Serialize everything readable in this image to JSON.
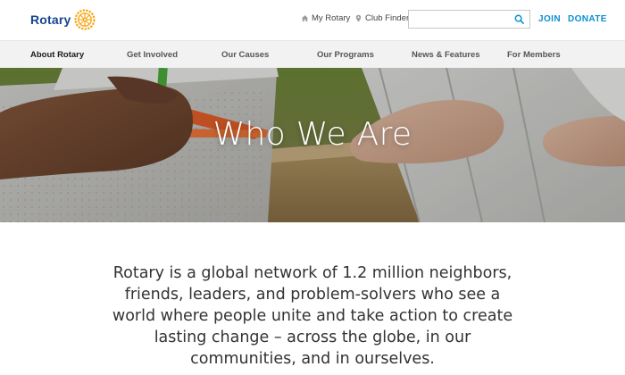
{
  "header": {
    "logo_text": "Rotary",
    "my_rotary": "My Rotary",
    "club_finder": "Club Finder",
    "search": {
      "value": "",
      "placeholder": ""
    },
    "join": "JOIN",
    "donate": "DONATE"
  },
  "nav": {
    "items": [
      {
        "label": "About Rotary",
        "active": true
      },
      {
        "label": "Get Involved",
        "active": false
      },
      {
        "label": "Our Causes",
        "active": false
      },
      {
        "label": "Our Programs",
        "active": false
      },
      {
        "label": "News & Features",
        "active": false
      },
      {
        "label": "For Members",
        "active": false
      }
    ]
  },
  "hero": {
    "title": "Who We Are"
  },
  "intro": {
    "text": "Rotary is a global network of 1.2 million neighbors, friends, leaders, and problem-solvers who see a world where people unite and take action to create lasting change – across the globe, in our communities, and in ourselves."
  },
  "colors": {
    "brand_blue": "#17458f",
    "brand_gold": "#f7a81b",
    "link_blue": "#0a8fcf",
    "nav_bg": "#f2f2f2"
  },
  "icons": {
    "my_rotary": "home-icon",
    "club_finder": "location-pin-icon",
    "search": "search-icon",
    "logo": "rotary-wheel-icon"
  }
}
